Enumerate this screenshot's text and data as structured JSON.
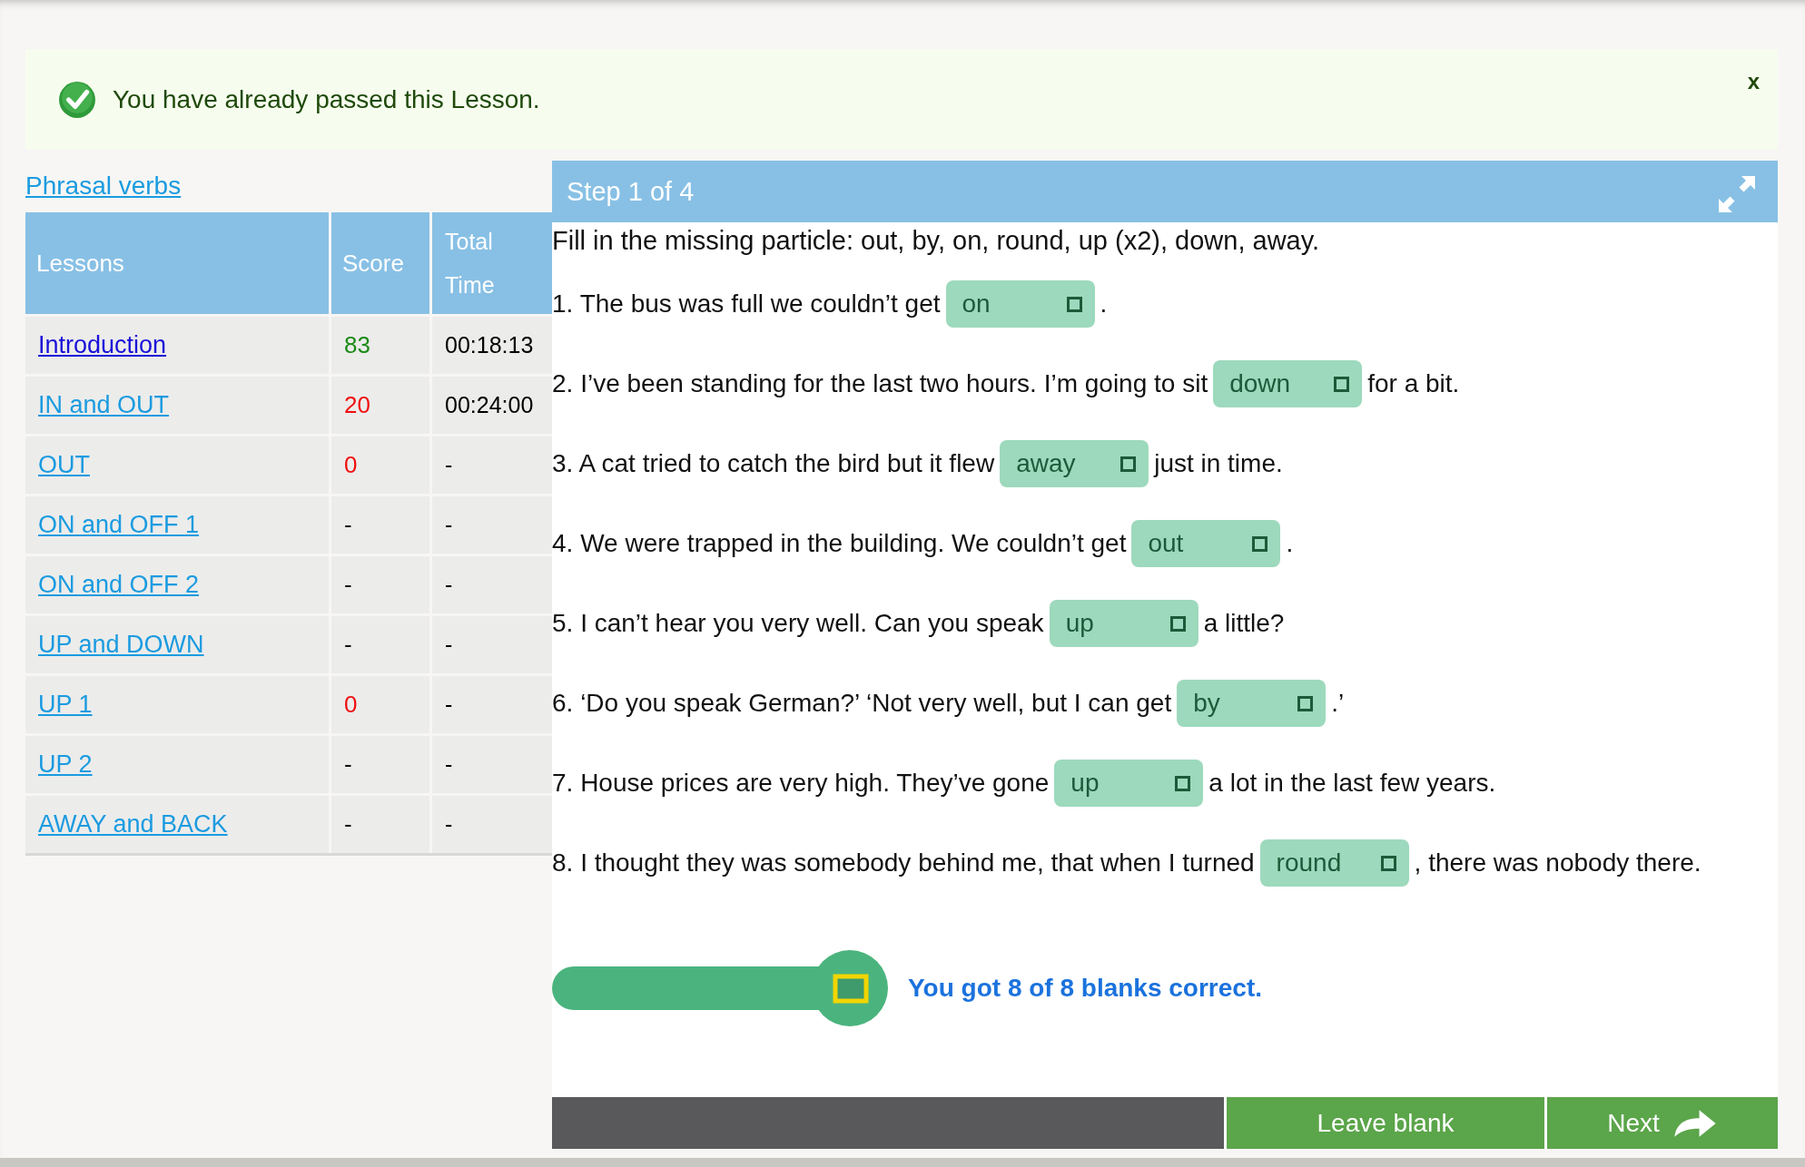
{
  "notice": {
    "message": "You have already passed this Lesson.",
    "close": "x"
  },
  "course_link": "Phrasal verbs",
  "lessons_table": {
    "columns": [
      "Lessons",
      "Score",
      "Total Time"
    ],
    "rows": [
      {
        "lesson": "Introduction",
        "visited": true,
        "score": "83",
        "color": "#1c8a17",
        "time": "00:18:13"
      },
      {
        "lesson": "IN and OUT",
        "visited": false,
        "score": "20",
        "color": "#f01010",
        "time": "00:24:00"
      },
      {
        "lesson": "OUT",
        "visited": false,
        "score": "0",
        "color": "#f01010",
        "time": "-"
      },
      {
        "lesson": "ON and OFF 1",
        "visited": false,
        "score": "-",
        "color": "#111111",
        "time": "-"
      },
      {
        "lesson": "ON and OFF 2",
        "visited": false,
        "score": "-",
        "color": "#111111",
        "time": "-"
      },
      {
        "lesson": "UP and DOWN",
        "visited": false,
        "score": "-",
        "color": "#111111",
        "time": "-"
      },
      {
        "lesson": "UP 1",
        "visited": false,
        "score": "0",
        "color": "#f01010",
        "time": "-"
      },
      {
        "lesson": "UP 2",
        "visited": false,
        "score": "-",
        "color": "#111111",
        "time": "-"
      },
      {
        "lesson": "AWAY and BACK",
        "visited": false,
        "score": "-",
        "color": "#111111",
        "time": "-"
      }
    ]
  },
  "exercise": {
    "step": "Step 1 of 4",
    "instruction": "Fill in the missing particle: out, by, on, round, up (x2), down, away.",
    "questions": [
      {
        "before": "1. The bus was full we couldn’t get",
        "answer": "on",
        "correct": true,
        "after": "."
      },
      {
        "before": "2. I’ve been standing for the last two hours. I’m going to sit",
        "answer": "down",
        "correct": true,
        "after": "for a bit."
      },
      {
        "before": "3. A cat tried to catch the bird but it flew",
        "answer": "away",
        "correct": true,
        "after": "just in time."
      },
      {
        "before": "4. We were trapped in the building.  We couldn’t get",
        "answer": "out",
        "correct": true,
        "after": "."
      },
      {
        "before": "5. I can’t hear you very well.  Can you speak",
        "answer": "up",
        "correct": true,
        "after": "a little?"
      },
      {
        "before": "6. ‘Do you speak German?’  ‘Not very well, but I can get",
        "answer": "by",
        "correct": true,
        "after": ".’"
      },
      {
        "before": "7. House prices are very high.  They’ve gone",
        "answer": "up",
        "correct": true,
        "after": "a lot in the last few years."
      },
      {
        "before": "8. I thought they was somebody behind me,  that when I turned",
        "answer": "round",
        "correct": true,
        "after": ",  there was nobody there."
      }
    ],
    "result": "You got 8 of 8 blanks correct.",
    "buttons": [
      "Leave blank",
      "Next"
    ]
  }
}
